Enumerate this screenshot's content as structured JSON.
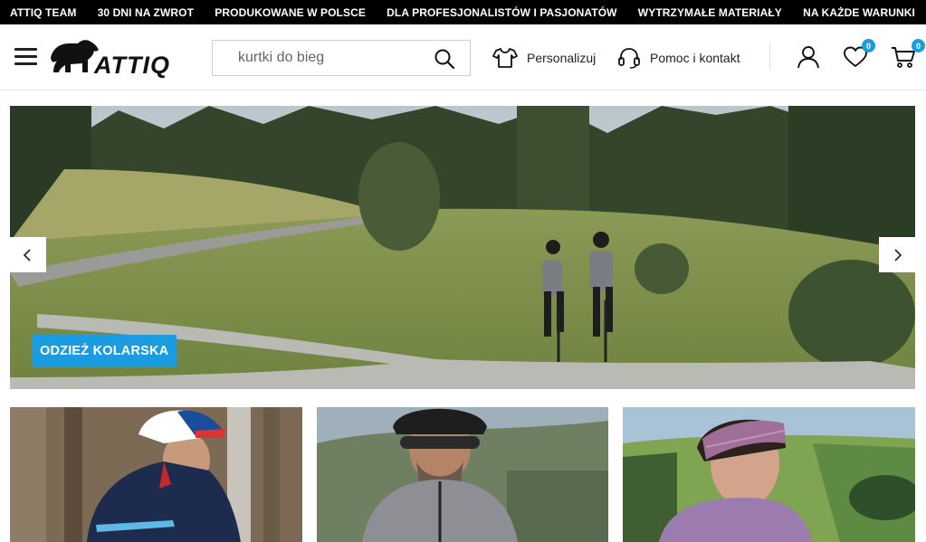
{
  "promo_bar": {
    "items": [
      "ATTIQ TEAM",
      "30 DNI NA ZWROT",
      "PRODUKOWANE W POLSCE",
      "DLA PROFESJONALISTÓW I PASJONATÓW",
      "WYTRZYMAŁE MATERIAŁY",
      "NA KAŻDE WARUNKI"
    ]
  },
  "header": {
    "logo_text": "ATTIQ",
    "search": {
      "value": "",
      "placeholder": "kurtki do bieg"
    },
    "personalize_label": "Personalizuj",
    "help_label": "Pomoc i kontakt",
    "wishlist_count": "0",
    "cart_count": "0"
  },
  "hero": {
    "tag_label": "ODZIEŻ KOLARSKA"
  },
  "colors": {
    "accent": "#1b9ce0",
    "promo_bg": "#000000"
  },
  "icons": [
    "menu-icon",
    "search-icon",
    "tshirt-icon",
    "headset-icon",
    "user-icon",
    "heart-icon",
    "cart-icon",
    "chevron-left-icon",
    "chevron-right-icon"
  ]
}
